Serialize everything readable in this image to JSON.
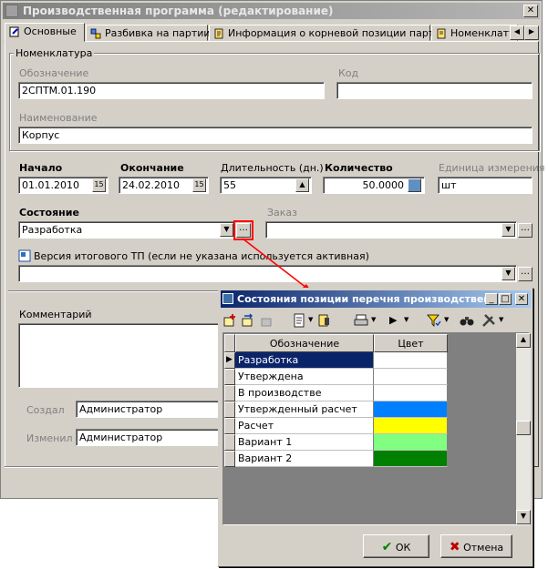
{
  "window": {
    "title": "Производственная программа (редактирование)",
    "minimize": "–",
    "close": "✕"
  },
  "tabs": [
    {
      "label": "Основные"
    },
    {
      "label": "Разбивка на партии"
    },
    {
      "label": "Информация о корневой позиции партии"
    },
    {
      "label": "Номенклату"
    }
  ],
  "nomenclature": {
    "group_label": "Номенклатура",
    "designation_label": "Обозначение",
    "designation_value": "2СПТМ.01.190",
    "code_label": "Код",
    "code_value": "",
    "name_label": "Наименование",
    "name_value": "Корпус"
  },
  "schedule": {
    "start_label": "Начало",
    "start_value": "01.01.2010",
    "end_label": "Окончание",
    "end_value": "24.02.2010",
    "duration_label": "Длительность (дн.)",
    "duration_value": "55",
    "quantity_label": "Количество",
    "quantity_value": "50.0000",
    "unit_label": "Единица измерения",
    "unit_value": "шт"
  },
  "state": {
    "label": "Состояние",
    "value": "Разработка",
    "order_label": "Заказ",
    "order_value": ""
  },
  "version": {
    "label": "Версия итогового ТП (если не указана используется активная)",
    "value": ""
  },
  "comment": {
    "label": "Комментарий"
  },
  "audit": {
    "created_label": "Создал",
    "created_value": "Администратор",
    "modified_label": "Изменил",
    "modified_value": "Администратор"
  },
  "dialog": {
    "title": "Состояния позиции перечня производствен...",
    "col_designation": "Обозначение",
    "col_color": "Цвет",
    "rows": [
      {
        "name": "Разработка",
        "color": "#ffffff"
      },
      {
        "name": "Утверждена",
        "color": "#ffffff"
      },
      {
        "name": "В производстве",
        "color": "#ffffff"
      },
      {
        "name": "Утвержденный расчет",
        "color": "#0080ff"
      },
      {
        "name": "Расчет",
        "color": "#ffff00"
      },
      {
        "name": "Вариант 1",
        "color": "#80ff80"
      },
      {
        "name": "Вариант 2",
        "color": "#008000"
      }
    ],
    "ok_label": "ОК",
    "cancel_label": "Отмена"
  },
  "colors": {
    "selection": "#0a246a",
    "arrow": "#ff0000"
  }
}
